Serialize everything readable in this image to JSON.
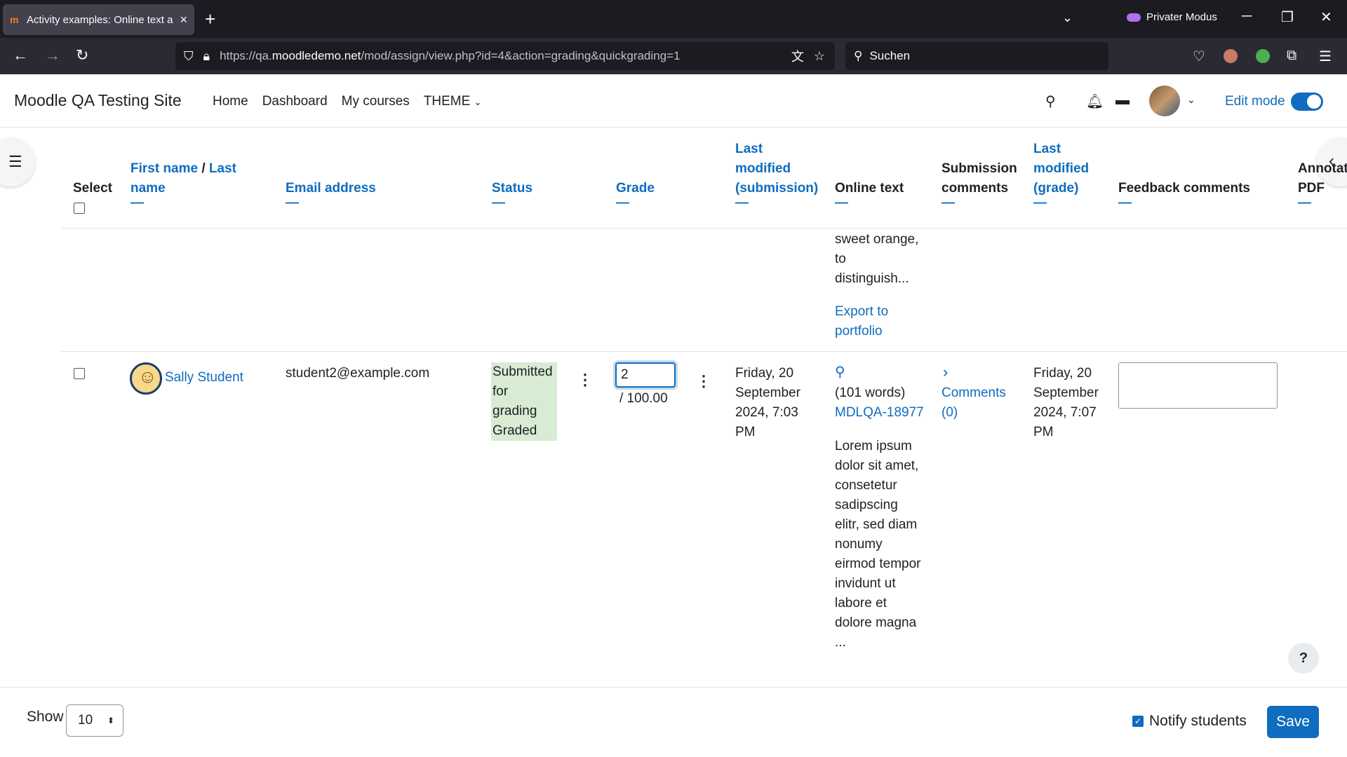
{
  "browser": {
    "tab_title": "Activity examples: Online text a",
    "url_prefix": "https://qa.",
    "url_domain": "moodledemo.net",
    "url_path": "/mod/assign/view.php?id=4&action=grading&quickgrading=1",
    "search_placeholder": "Suchen",
    "private_label": "Privater Modus"
  },
  "nav": {
    "brand": "Moodle QA Testing Site",
    "items": [
      "Home",
      "Dashboard",
      "My courses",
      "THEME"
    ],
    "edit_mode_label": "Edit mode",
    "edit_mode_on": true
  },
  "table": {
    "headers": {
      "select": "Select",
      "first_name": "First name",
      "slash": "/",
      "last_name": "Last name",
      "email": "Email address",
      "status": "Status",
      "grade": "Grade",
      "last_modified_submission": "Last modified (submission)",
      "online_text": "Online text",
      "submission_comments": "Submission comments",
      "last_modified_grade": "Last modified (grade)",
      "feedback_comments": "Feedback comments",
      "annotate_pdf": "Annotate PDF",
      "collapse": "—"
    },
    "prev_row": {
      "online_text_tail": "sweet orange, to distinguish...",
      "export_link": "Export to portfolio"
    },
    "row": {
      "name": "Sally Student",
      "email": "student2@example.com",
      "status": "Submitted for grading Graded",
      "grade_value": "2",
      "grade_max": "/ 100.00",
      "last_modified_submission": "Friday, 20 September 2024, 7:03 PM",
      "word_count": "(101 words)",
      "online_text_link": "MDLQA-18977",
      "online_text_preview": "Lorem ipsum dolor sit amet, consetetur sadipscing elitr, sed diam nonumy eirmod tempor invidunt ut labore et dolore magna ...",
      "comments_link": "Comments (0)",
      "last_modified_grade": "Friday, 20 September 2024, 7:07 PM"
    }
  },
  "footer": {
    "show_label": "Show",
    "show_value": "10",
    "notify_label": "Notify students",
    "notify_checked": true,
    "save_label": "Save"
  },
  "colors": {
    "accent": "#0f6cbf",
    "status_bg": "#d7ecd3"
  }
}
